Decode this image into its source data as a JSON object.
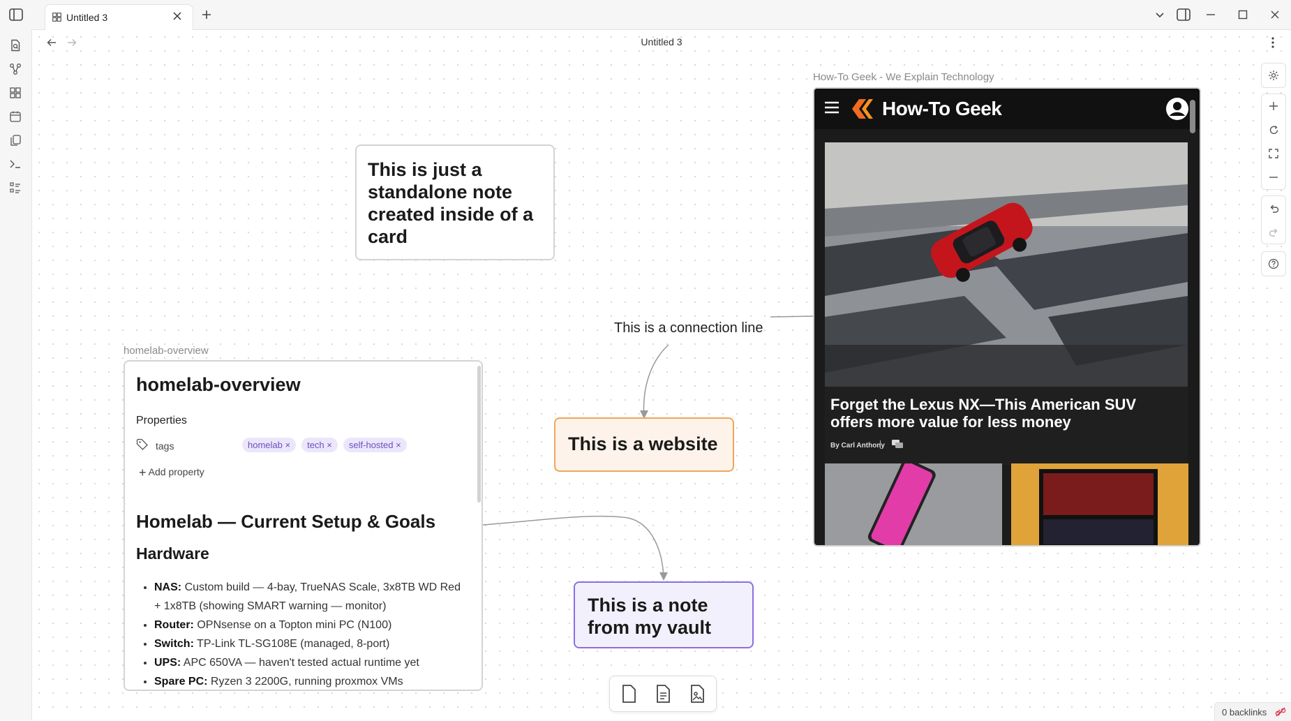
{
  "tab": {
    "title": "Untitled 3"
  },
  "header": {
    "title": "Untitled 3"
  },
  "canvas": {
    "standalone_card": {
      "text": "This is just a standalone note created inside of a card"
    },
    "connection_label": "This is a connection line",
    "website_card": {
      "text": "This is a website"
    },
    "vault_card": {
      "text": "This is a note from my vault"
    },
    "homelab": {
      "label": "homelab-overview",
      "title": "homelab-overview",
      "properties_heading": "Properties",
      "tags_label": "tags",
      "tags": [
        "homelab",
        "tech",
        "self-hosted"
      ],
      "add_property": "Add property",
      "h1": "Homelab — Current Setup & Goals",
      "h2": "Hardware",
      "items": [
        {
          "key": "NAS:",
          "text": "Custom build — 4-bay, TrueNAS Scale, 3x8TB WD Red + 1x8TB (showing SMART warning — monitor)"
        },
        {
          "key": "Router:",
          "text": "OPNsense on a Topton mini PC (N100)"
        },
        {
          "key": "Switch:",
          "text": "TP-Link TL-SG108E (managed, 8-port)"
        },
        {
          "key": "UPS:",
          "text": "APC 650VA — haven't tested actual runtime yet"
        },
        {
          "key": "Spare PC:",
          "text": "Ryzen 3 2200G, running proxmox VMs"
        }
      ]
    },
    "web_embed": {
      "label": "How-To Geek - We Explain Technology",
      "brand": "How-To Geek",
      "headline": "Forget the Lexus NX—This American SUV offers more value for less money",
      "byline": "By Carl Anthony"
    }
  },
  "status": {
    "backlinks": "0 backlinks"
  },
  "icons": [
    "sidebar-toggle-icon",
    "grid-icon",
    "close-icon",
    "plus-icon",
    "chevron-down-icon",
    "split-icon",
    "minimize-icon",
    "maximize-icon",
    "window-close-icon",
    "file-search-icon",
    "graph-icon",
    "canvas-icon",
    "calendar-icon",
    "copy-icon",
    "terminal-icon",
    "list-icon",
    "back-icon",
    "forward-icon",
    "more-icon",
    "settings-icon",
    "zoom-in-icon",
    "reset-icon",
    "fit-icon",
    "zoom-out-icon",
    "undo-icon",
    "redo-icon",
    "help-icon",
    "new-card-icon",
    "note-icon",
    "media-icon",
    "backlink-icon"
  ],
  "colors": {
    "accent_purple": "#8b6fe0",
    "website_orange": "#f0a65a",
    "tag_bg": "#ece6fb",
    "tag_text": "#6b4fbf",
    "htg_orange": "#f26b21"
  }
}
